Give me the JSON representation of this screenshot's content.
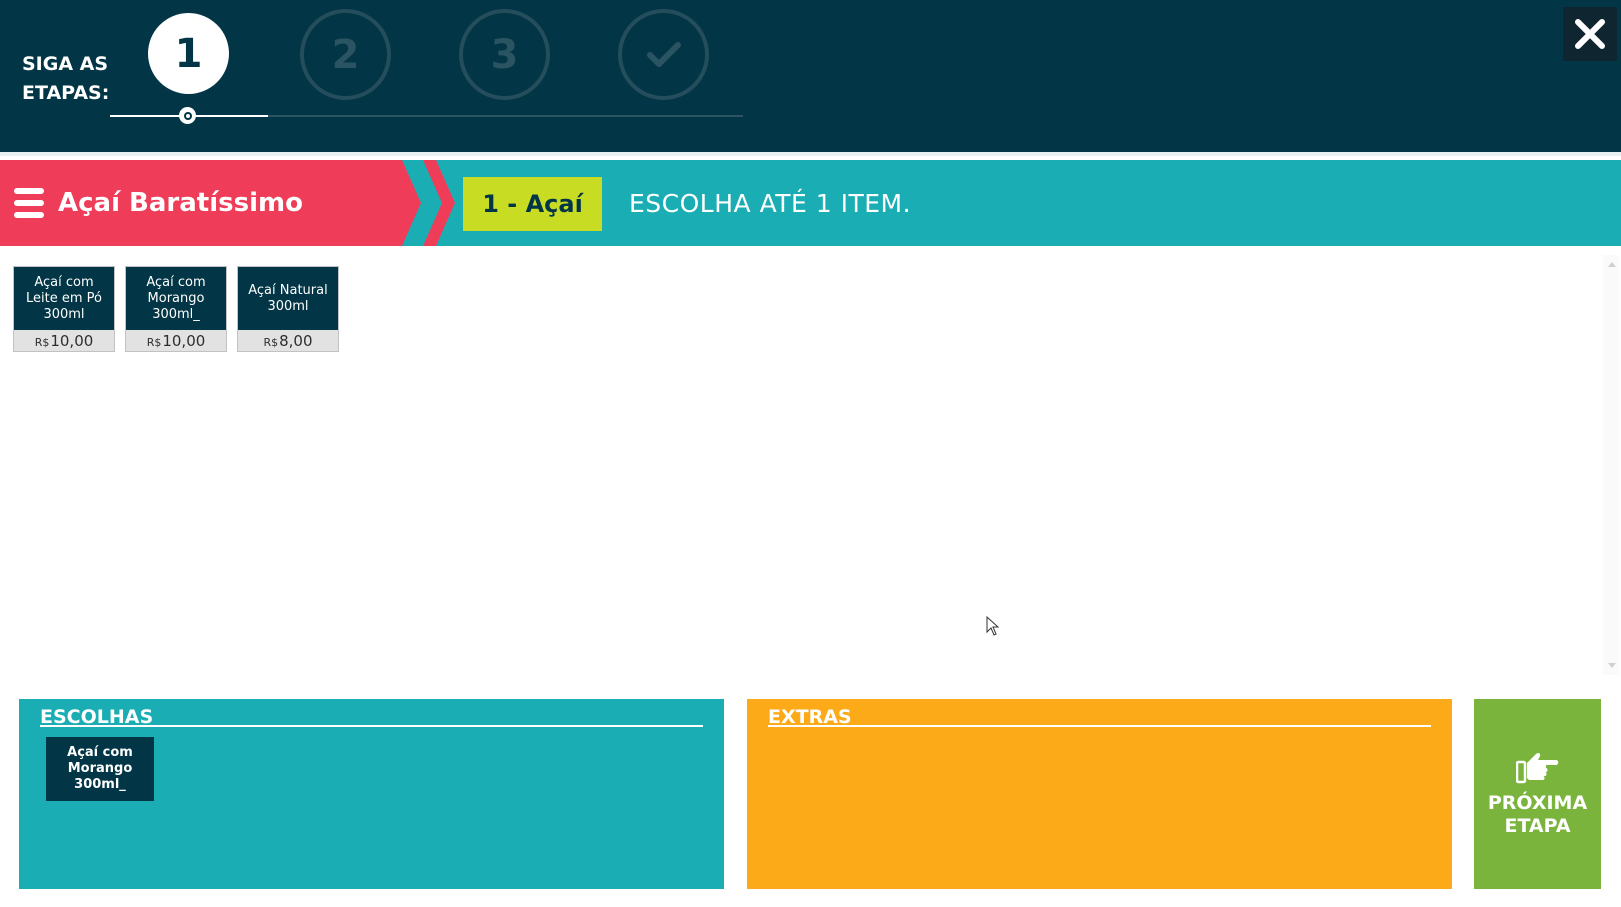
{
  "header": {
    "steps_title": "SIGA AS ETAPAS:",
    "steps": [
      {
        "label": "1",
        "state": "active"
      },
      {
        "label": "2",
        "state": "inactive"
      },
      {
        "label": "3",
        "state": "inactive"
      },
      {
        "icon": "check-icon",
        "state": "inactive"
      }
    ],
    "progress_fraction": 0.25,
    "close_icon": "close-icon"
  },
  "category": {
    "menu_icon": "menu-icon",
    "title": "Açaí Baratíssimo",
    "step_badge": "1 - Açaí",
    "instruction": "ESCOLHA ATÉ 1 ITEM."
  },
  "products": [
    {
      "name": "Açaí com Leite em Pó 300ml",
      "currency": "R$",
      "price": "10,00"
    },
    {
      "name": "Açaí com Morango 300ml_",
      "currency": "R$",
      "price": "10,00"
    },
    {
      "name": "Açaí Natural 300ml",
      "currency": "R$",
      "price": "8,00"
    }
  ],
  "escolhas": {
    "title": "ESCOLHAS",
    "items": [
      {
        "name": "Açaí com Morango 300ml_"
      }
    ]
  },
  "extras": {
    "title": "EXTRAS"
  },
  "next": {
    "icon": "pointing-hand-icon",
    "label": "PRÓXIMA ETAPA"
  },
  "colors": {
    "header_bg": "#023545",
    "category_red": "#ef3d59",
    "teal": "#1aaeb4",
    "badge_yellow": "#c9dc24",
    "extras_orange": "#fcaa18",
    "next_green": "#7ab43c"
  }
}
